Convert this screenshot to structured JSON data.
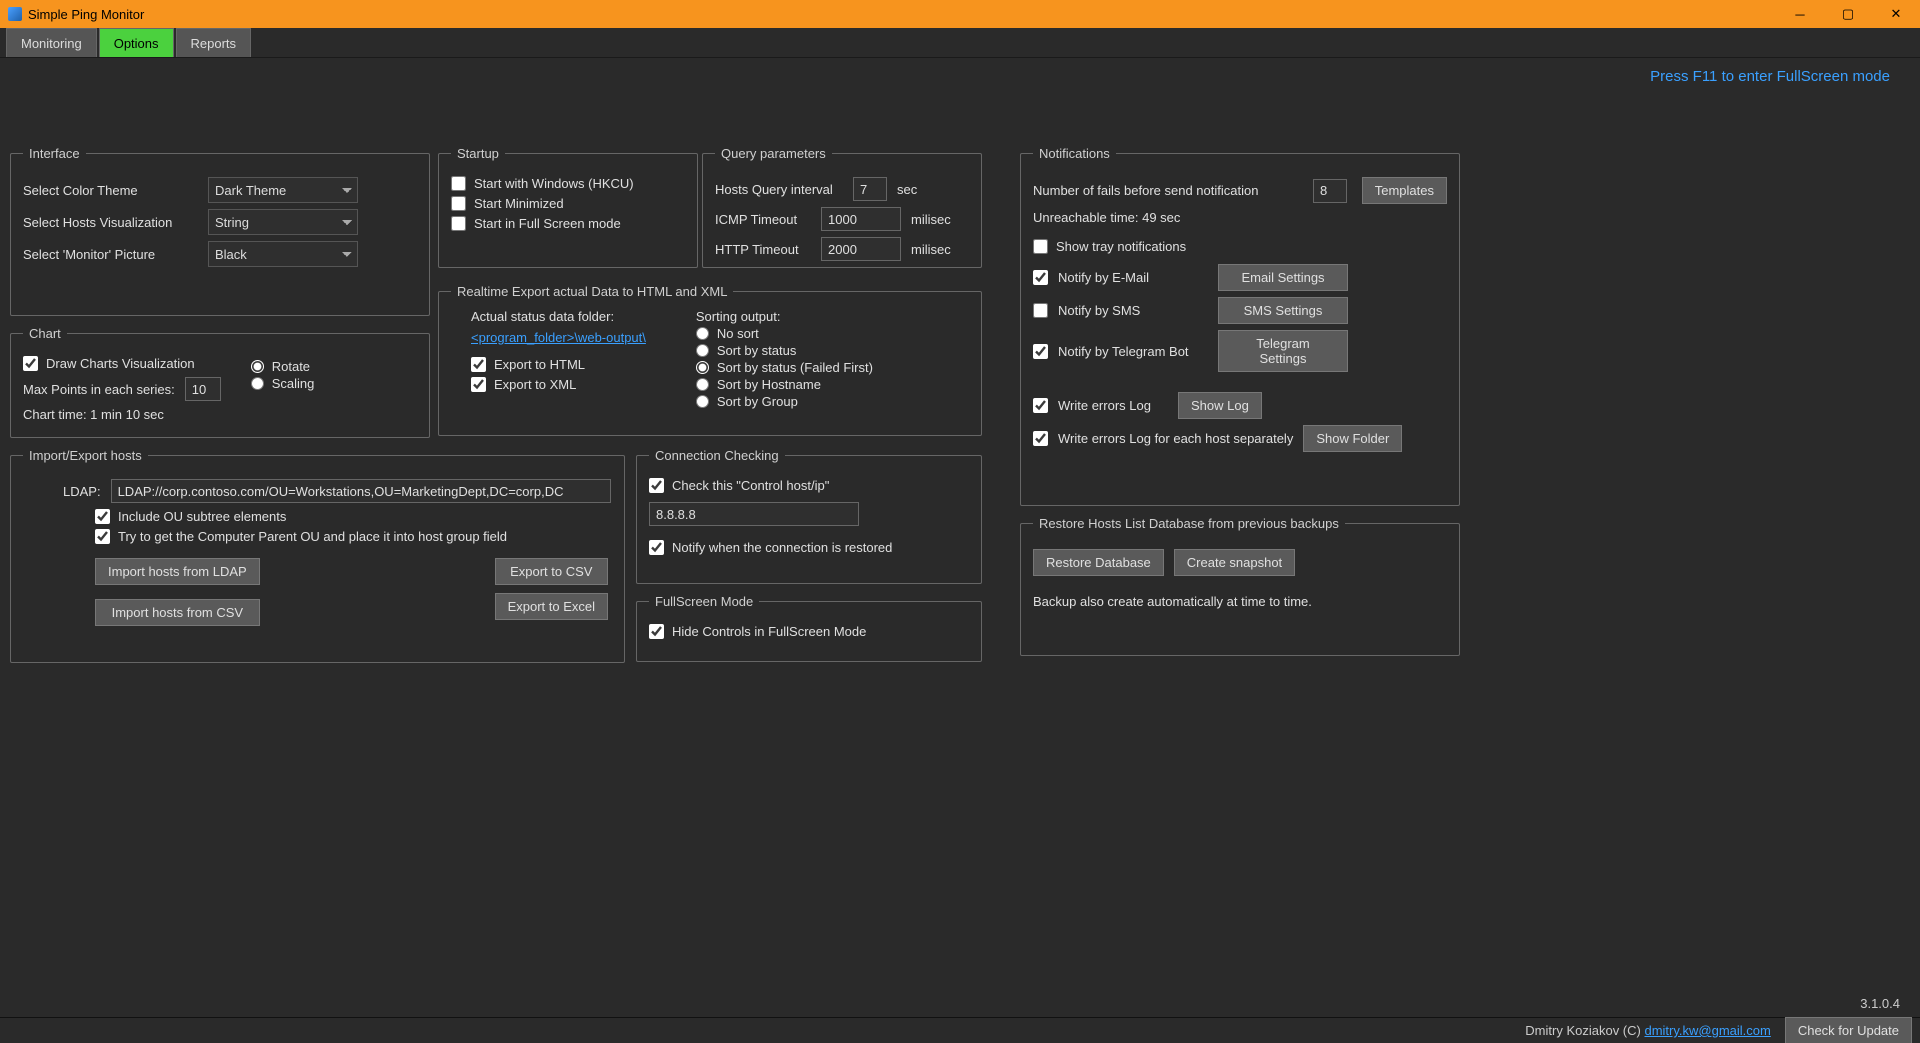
{
  "title": "Simple Ping Monitor",
  "tabs": [
    "Monitoring",
    "Options",
    "Reports"
  ],
  "fshint": "Press F11 to enter FullScreen mode",
  "interface": {
    "legend": "Interface",
    "color_label": "Select Color Theme",
    "color_value": "Dark Theme",
    "hosts_label": "Select Hosts Visualization",
    "hosts_value": "String",
    "monitor_label": "Select 'Monitor' Picture",
    "monitor_value": "Black"
  },
  "chart": {
    "legend": "Chart",
    "draw_label": "Draw Charts Visualization",
    "maxpoints_label": "Max Points in each series:",
    "maxpoints_value": "10",
    "rotate": "Rotate",
    "scaling": "Scaling",
    "time_label": "Chart time: 1 min 10 sec"
  },
  "import": {
    "legend": "Import/Export hosts",
    "ldap_label": "LDAP:",
    "ldap_value": "LDAP://corp.contoso.com/OU=Workstations,OU=MarketingDept,DC=corp,DC",
    "include_ou": "Include OU subtree elements",
    "try_parent": "Try to get the Computer Parent OU and place it into host group field",
    "btn_ldap": "Import hosts from LDAP",
    "btn_csv_import": "Import hosts from CSV",
    "btn_csv_export": "Export to CSV",
    "btn_excel": "Export to Excel"
  },
  "startup": {
    "legend": "Startup",
    "start_win": "Start with Windows (HKCU)",
    "start_min": "Start Minimized",
    "start_full": "Start in Full Screen mode"
  },
  "query": {
    "legend": "Query parameters",
    "interval_label": "Hosts Query interval",
    "interval_value": "7",
    "interval_unit": "sec",
    "icmp_label": "ICMP Timeout",
    "icmp_value": "1000",
    "icmp_unit": "milisec",
    "http_label": "HTTP Timeout",
    "http_value": "2000",
    "http_unit": "milisec"
  },
  "realtime": {
    "legend": "Realtime Export actual Data to HTML and XML",
    "folder_label": "Actual status data folder:",
    "folder_link": "<program_folder>\\web-output\\",
    "export_html": "Export to HTML",
    "export_xml": "Export to XML",
    "sort_label": "Sorting output:",
    "sort_opts": [
      "No sort",
      "Sort by status",
      "Sort by status (Failed First)",
      "Sort by Hostname",
      "Sort by Group"
    ]
  },
  "conn": {
    "legend": "Connection Checking",
    "check_label": "Check this \"Control host/ip\"",
    "host_value": "8.8.8.8",
    "notify_label": "Notify when the connection is restored"
  },
  "fullscreen": {
    "legend": "FullScreen Mode",
    "hide_label": "Hide Controls in FullScreen Mode"
  },
  "notif": {
    "legend": "Notifications",
    "fails_label": "Number of fails before send notification",
    "fails_value": "8",
    "templates_btn": "Templates",
    "unreach": "Unreachable time: 49 sec",
    "tray": "Show tray notifications",
    "email": "Notify by E-Mail",
    "email_btn": "Email Settings",
    "sms": "Notify by SMS",
    "sms_btn": "SMS Settings",
    "telegram": "Notify by Telegram Bot",
    "telegram_btn": "Telegram Settings",
    "log": "Write errors Log",
    "log_btn": "Show Log",
    "log_each": "Write errors Log for each host separately",
    "folder_btn": "Show Folder"
  },
  "restore": {
    "legend": "Restore Hosts List Database from previous backups",
    "restore_btn": "Restore Database",
    "snapshot_btn": "Create snapshot",
    "note": "Backup also create automatically at time to time."
  },
  "version": "3.1.0.4",
  "author": "Dmitry Koziakov (C) ",
  "email": "dmitry.kw@gmail.com",
  "update_btn": "Check for Update"
}
